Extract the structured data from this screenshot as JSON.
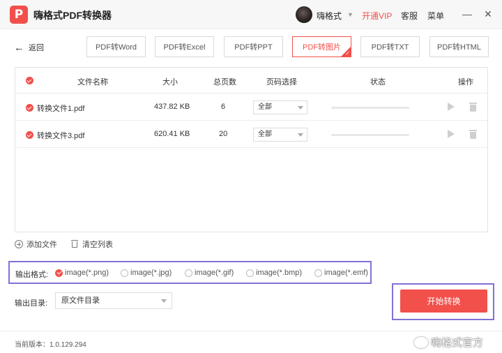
{
  "app": {
    "title": "嗨格式PDF转换器"
  },
  "header": {
    "username": "嗨格式",
    "vip": "开通VIP",
    "service": "客服",
    "menu": "菜单"
  },
  "window": {
    "minimize": "—",
    "close": "✕"
  },
  "nav": {
    "back": "返回"
  },
  "tabs": [
    {
      "label": "PDF转Word",
      "active": false
    },
    {
      "label": "PDF转Excel",
      "active": false
    },
    {
      "label": "PDF转PPT",
      "active": false
    },
    {
      "label": "PDF转图片",
      "active": true
    },
    {
      "label": "PDF转TXT",
      "active": false
    },
    {
      "label": "PDF转HTML",
      "active": false
    }
  ],
  "table": {
    "headers": {
      "name": "文件名称",
      "size": "大小",
      "pages": "总页数",
      "page_select": "页码选择",
      "status": "状态",
      "actions": "操作"
    },
    "rows": [
      {
        "name": "转换文件1.pdf",
        "size": "437.82 KB",
        "pages": "6",
        "page_select": "全部",
        "progress": 0
      },
      {
        "name": "转换文件3.pdf",
        "size": "620.41 KB",
        "pages": "20",
        "page_select": "全部",
        "progress": 0
      }
    ]
  },
  "actions": {
    "add_file": "添加文件",
    "clear_list": "清空列表"
  },
  "output": {
    "format_label": "输出格式:",
    "formats": [
      {
        "label": "image(*.png)",
        "selected": true
      },
      {
        "label": "image(*.jpg)",
        "selected": false
      },
      {
        "label": "image(*.gif)",
        "selected": false
      },
      {
        "label": "image(*.bmp)",
        "selected": false
      },
      {
        "label": "image(*.emf)",
        "selected": false
      }
    ],
    "dir_label": "输出目录:",
    "dir_value": "原文件目录"
  },
  "start_button": "开始转换",
  "footer": {
    "version": "当前版本：1.0.129.294",
    "watermark": "嗨格式官方"
  },
  "colors": {
    "accent": "#f2504b",
    "highlight_frame": "#7e72d8"
  }
}
